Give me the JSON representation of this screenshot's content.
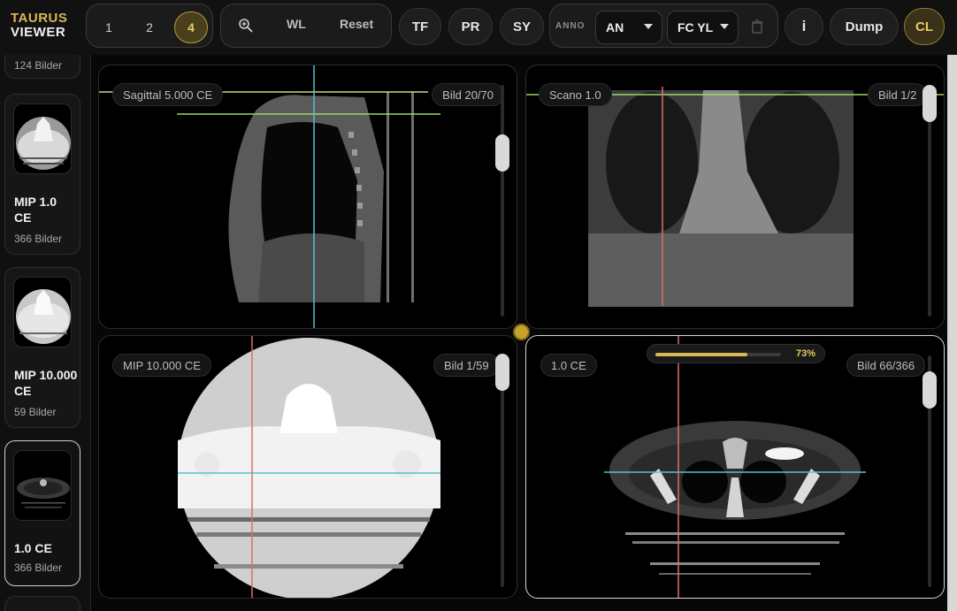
{
  "app": {
    "logo_line1": "TAURUS",
    "logo_line2": "VIEWER"
  },
  "toolbar": {
    "layouts": [
      "1",
      "2",
      "4"
    ],
    "active_layout": "4",
    "zoom_icon": "zoom-in-icon",
    "wl_label": "WL",
    "reset_label": "Reset",
    "tf_label": "TF",
    "pr_label": "PR",
    "sy_label": "SY",
    "anno_label": "ANNO",
    "anno_select": "AN",
    "color_select": "FC YL",
    "trash_icon": "trash-icon",
    "info_label": "i",
    "dump_label": "Dump",
    "cl_label": "CL"
  },
  "sidebar": {
    "series": [
      {
        "title": "",
        "count": "124 Bilder"
      },
      {
        "title": "MIP 1.0 CE",
        "count": "366 Bilder"
      },
      {
        "title": "MIP 10.000 CE",
        "count": "59 Bilder"
      },
      {
        "title": "1.0 CE",
        "count": "366 Bilder",
        "selected": true
      }
    ]
  },
  "viewports": {
    "top_left": {
      "label": "Sagittal 5.000 CE",
      "image_counter": "Bild 20/70",
      "slice_position": 0.12
    },
    "top_right": {
      "label": "Scano 1.0",
      "image_counter": "Bild 1/2",
      "slice_position": 0.0
    },
    "bottom_left": {
      "label": "MIP 10.000 CE",
      "image_counter": "Bild 1/59",
      "slice_position": 0.0
    },
    "bottom_right": {
      "label": "1.0 CE",
      "image_counter": "Bild 66/366",
      "slice_position": 0.15,
      "loading_percent_label": "73%",
      "loading_fraction": 0.73
    }
  },
  "colors": {
    "accent_gold": "#d9b755",
    "crosshair_cyan": "#4fc3cf",
    "crosshair_red": "#e06c6c",
    "crosshair_yellow": "#d8d27a",
    "crosshair_green": "#9bd56a"
  }
}
